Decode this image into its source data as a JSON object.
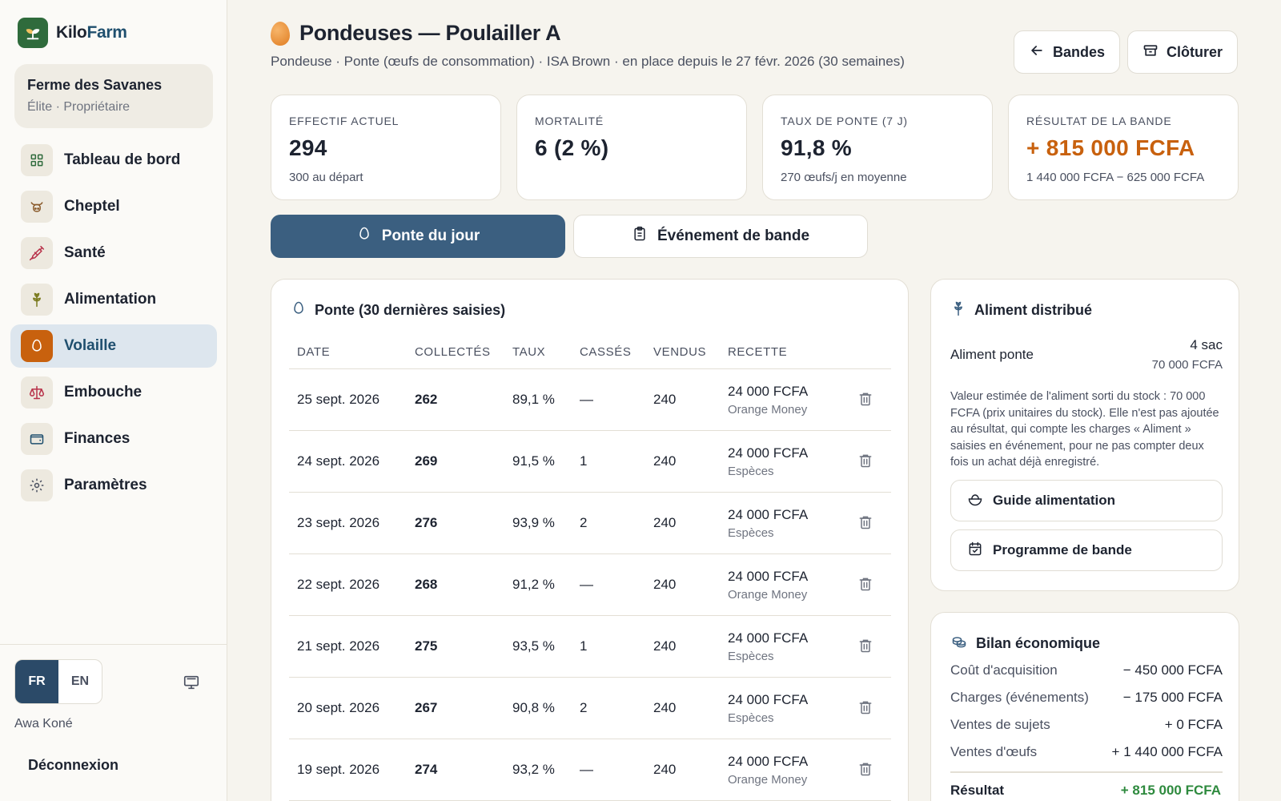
{
  "brand": {
    "name_part1": "Kilo",
    "name_part2": "Farm"
  },
  "farm": {
    "name": "Ferme des Savanes",
    "role": "Élite · Propriétaire"
  },
  "nav": [
    {
      "label": "Tableau de bord",
      "icon": "dashboard-icon"
    },
    {
      "label": "Cheptel",
      "icon": "cow-icon"
    },
    {
      "label": "Santé",
      "icon": "syringe-icon"
    },
    {
      "label": "Alimentation",
      "icon": "wheat-icon"
    },
    {
      "label": "Volaille",
      "icon": "egg-icon",
      "active": true
    },
    {
      "label": "Embouche",
      "icon": "scale-icon"
    },
    {
      "label": "Finances",
      "icon": "wallet-icon"
    },
    {
      "label": "Paramètres",
      "icon": "gear-icon"
    }
  ],
  "lang": {
    "fr": "FR",
    "en": "EN",
    "selected": "FR"
  },
  "user": {
    "name": "Awa Koné",
    "logout": "Déconnexion"
  },
  "header": {
    "title": "Pondeuses — Poulailler A",
    "subtitle": "Pondeuse · Ponte (œufs de consommation) · ISA Brown · en place depuis le 27 févr. 2026 (30 semaines)",
    "back_label": "Bandes",
    "close_label": "Clôturer"
  },
  "kpis": [
    {
      "label": "Effectif actuel",
      "value": "294",
      "sub": "300 au départ"
    },
    {
      "label": "Mortalité",
      "value": "6 (2 %)",
      "sub": ""
    },
    {
      "label": "Taux de ponte (7 j)",
      "value": "91,8 %",
      "sub": "270 œufs/j en moyenne"
    },
    {
      "label": "Résultat de la bande",
      "value": "+ 815 000 FCFA",
      "sub": "1 440 000 FCFA − 625 000 FCFA"
    }
  ],
  "actions": {
    "primary": "Ponte du jour",
    "secondary": "Événement de bande"
  },
  "ponte": {
    "title": "Ponte (30 dernières saisies)",
    "columns": [
      "Date",
      "Collectés",
      "Taux",
      "Cassés",
      "Vendus",
      "Recette"
    ],
    "rows": [
      {
        "date": "25 sept. 2026",
        "collectes": "262",
        "taux": "89,1 %",
        "casses": "—",
        "vendus": "240",
        "recette": "24 000 FCFA",
        "paiement": "Orange Money"
      },
      {
        "date": "24 sept. 2026",
        "collectes": "269",
        "taux": "91,5 %",
        "casses": "1",
        "vendus": "240",
        "recette": "24 000 FCFA",
        "paiement": "Espèces"
      },
      {
        "date": "23 sept. 2026",
        "collectes": "276",
        "taux": "93,9 %",
        "casses": "2",
        "vendus": "240",
        "recette": "24 000 FCFA",
        "paiement": "Espèces"
      },
      {
        "date": "22 sept. 2026",
        "collectes": "268",
        "taux": "91,2 %",
        "casses": "—",
        "vendus": "240",
        "recette": "24 000 FCFA",
        "paiement": "Orange Money"
      },
      {
        "date": "21 sept. 2026",
        "collectes": "275",
        "taux": "93,5 %",
        "casses": "1",
        "vendus": "240",
        "recette": "24 000 FCFA",
        "paiement": "Espèces"
      },
      {
        "date": "20 sept. 2026",
        "collectes": "267",
        "taux": "90,8 %",
        "casses": "2",
        "vendus": "240",
        "recette": "24 000 FCFA",
        "paiement": "Espèces"
      },
      {
        "date": "19 sept. 2026",
        "collectes": "274",
        "taux": "93,2 %",
        "casses": "—",
        "vendus": "240",
        "recette": "24 000 FCFA",
        "paiement": "Orange Money"
      }
    ]
  },
  "feed": {
    "title": "Aliment distribué",
    "item_name": "Aliment ponte",
    "item_qty": "4 sac",
    "item_value": "70 000 FCFA",
    "note": "Valeur estimée de l'aliment sorti du stock : 70 000 FCFA (prix unitaires du stock). Elle n'est pas ajoutée au résultat, qui compte les charges « Aliment » saisies en événement, pour ne pas compter deux fois un achat déjà enregistré.",
    "guide_label": "Guide alimentation",
    "programme_label": "Programme de bande"
  },
  "bilan": {
    "title": "Bilan économique",
    "rows": [
      {
        "label": "Coût d'acquisition",
        "value": "− 450 000 FCFA"
      },
      {
        "label": "Charges (événements)",
        "value": "− 175 000 FCFA"
      },
      {
        "label": "Ventes de sujets",
        "value": "+ 0 FCFA"
      },
      {
        "label": "Ventes d'œufs",
        "value": "+ 1 440 000 FCFA"
      }
    ],
    "total_label": "Résultat",
    "total_value": "+ 815 000 FCFA"
  },
  "colors": {
    "accent": "#3b5f80",
    "orange": "#c8610e",
    "green": "#2e8a3e",
    "brand_green": "#2f6b3c"
  }
}
